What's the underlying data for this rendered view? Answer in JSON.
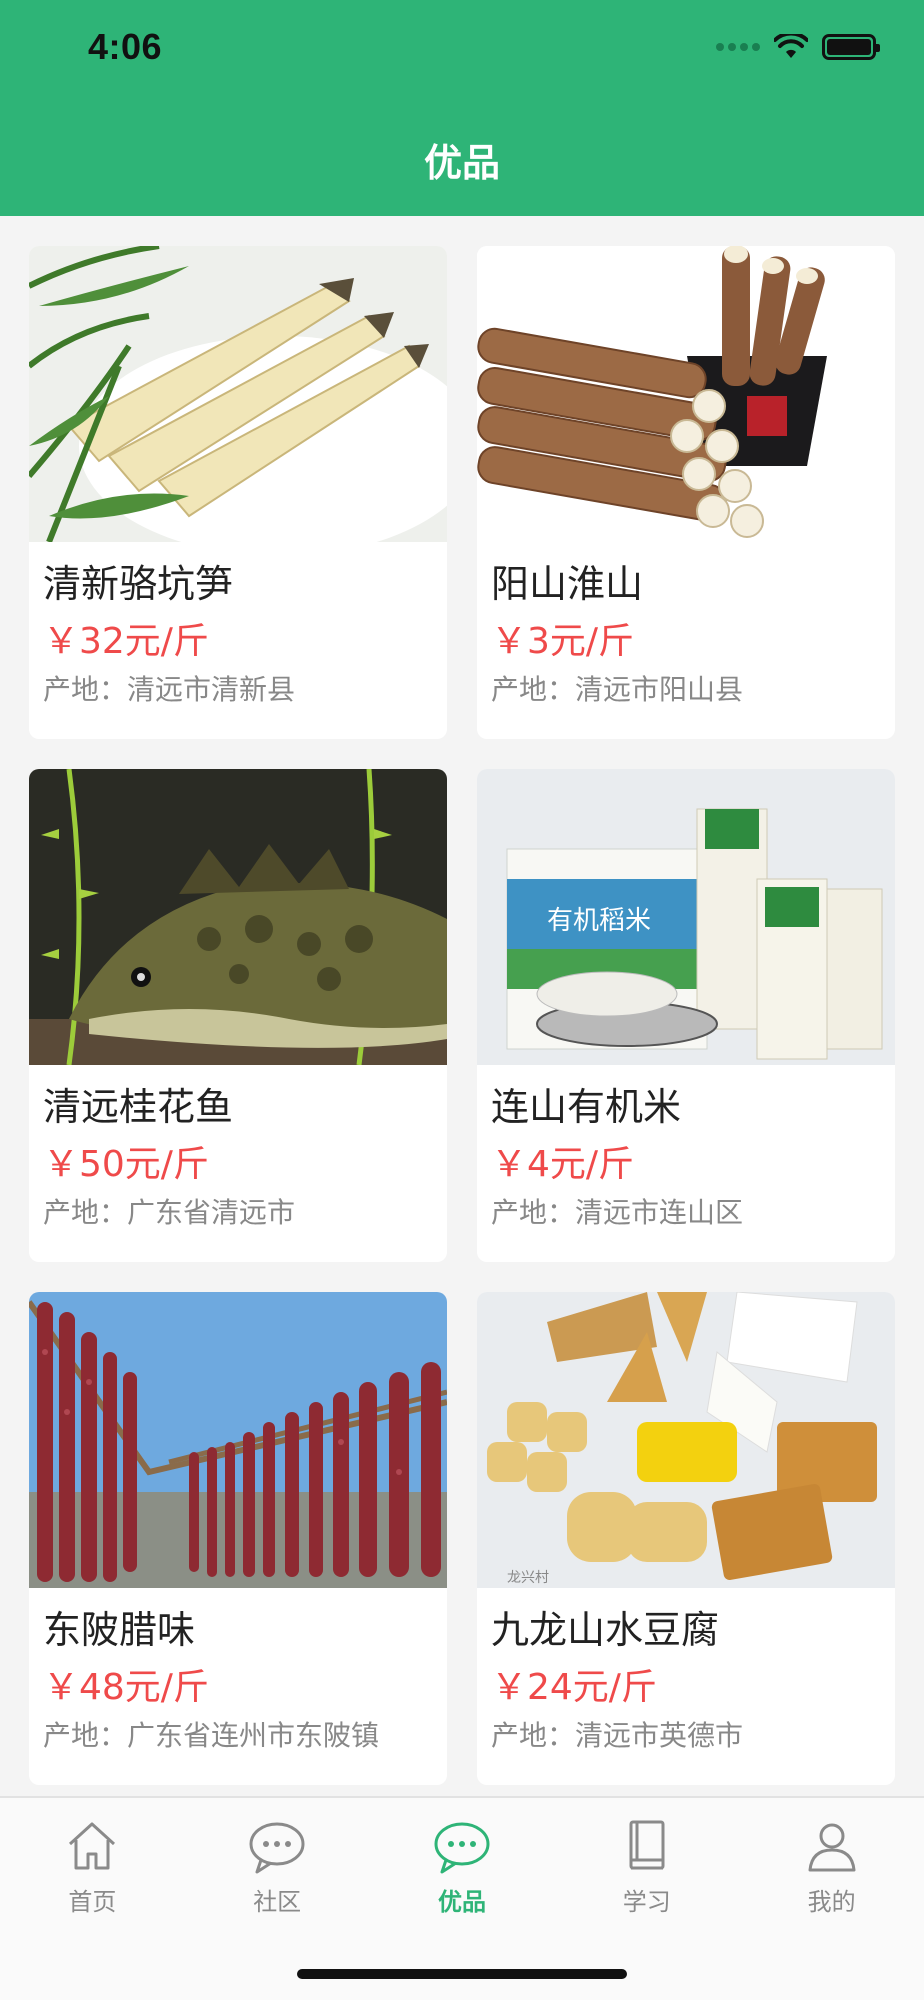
{
  "status_bar": {
    "time": "4:06"
  },
  "header": {
    "title": "优品"
  },
  "products": [
    {
      "name": "清新骆坑笋",
      "price": "￥32元/斤",
      "origin": "产地：清远市清新县",
      "image": "bamboo-shoots"
    },
    {
      "name": "阳山淮山",
      "price": "￥3元/斤",
      "origin": "产地：清远市阳山县",
      "image": "chinese-yam"
    },
    {
      "name": "清远桂花鱼",
      "price": "￥50元/斤",
      "origin": "产地：广东省清远市",
      "image": "mandarin-fish"
    },
    {
      "name": "连山有机米",
      "price": "￥4元/斤",
      "origin": "产地：清远市连山区",
      "image": "organic-rice",
      "image_text": "有机稻米"
    },
    {
      "name": "东陂腊味",
      "price": "￥48元/斤",
      "origin": "产地：广东省连州市东陂镇",
      "image": "cured-sausages"
    },
    {
      "name": "九龙山水豆腐",
      "price": "￥24元/斤",
      "origin": "产地：清远市英德市",
      "image": "tofu"
    }
  ],
  "tabbar": {
    "items": [
      {
        "label": "首页",
        "icon": "home-icon"
      },
      {
        "label": "社区",
        "icon": "chat-icon"
      },
      {
        "label": "优品",
        "icon": "chat-icon",
        "active": true
      },
      {
        "label": "学习",
        "icon": "book-icon"
      },
      {
        "label": "我的",
        "icon": "user-icon"
      }
    ]
  },
  "colors": {
    "accent": "#2eb477",
    "price": "#ef4a4a",
    "muted": "#888888"
  }
}
